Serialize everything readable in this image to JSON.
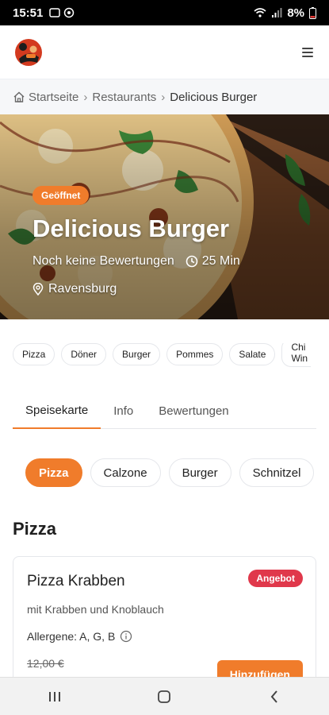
{
  "status_bar": {
    "time": "15:51",
    "battery": "8%"
  },
  "breadcrumb": {
    "items": [
      "Startseite",
      "Restaurants",
      "Delicious Burger"
    ]
  },
  "hero": {
    "badge": "Geöffnet",
    "title": "Delicious Burger",
    "rating_text": "Noch keine Bewertungen",
    "delivery_time": "25 Min",
    "location": "Ravensburg"
  },
  "categories": [
    "Pizza",
    "Döner",
    "Burger",
    "Pommes",
    "Salate",
    "Chi",
    "Win"
  ],
  "tabs": [
    "Speisekarte",
    "Info",
    "Bewertungen"
  ],
  "menu_categories": [
    "Pizza",
    "Calzone",
    "Burger",
    "Schnitzel"
  ],
  "section": {
    "title": "Pizza"
  },
  "item": {
    "name": "Pizza Krabben",
    "badge": "Angebot",
    "description": "mit Krabben und Knoblauch",
    "allergens": "Allergene: A, G, B",
    "old_price": "12,00 €",
    "add_label": "Hinzufügen"
  },
  "colors": {
    "accent": "#f07c2b",
    "offer": "#e0384b"
  },
  "icons": [
    "wifi-icon",
    "signal-icon",
    "battery-icon",
    "menu-icon",
    "home-icon",
    "clock-icon",
    "location-pin-icon",
    "info-icon",
    "recents-icon",
    "home-nav-icon",
    "back-icon"
  ]
}
